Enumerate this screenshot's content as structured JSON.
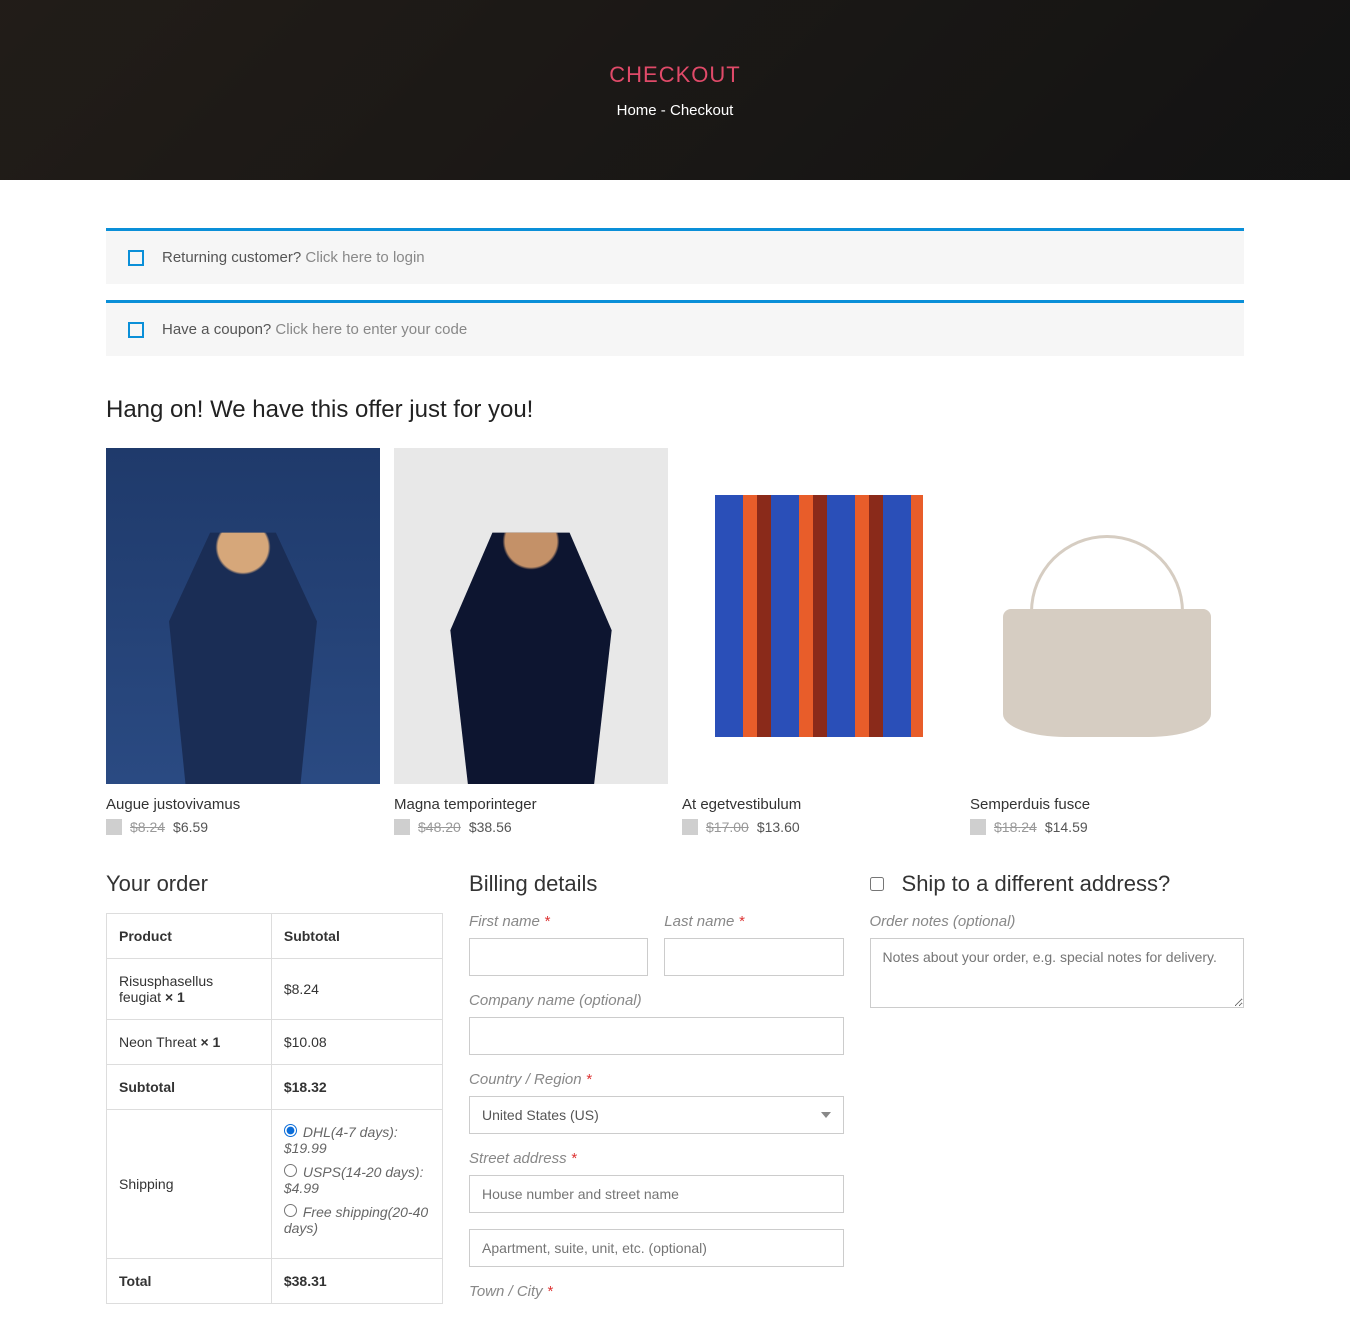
{
  "hero": {
    "title": "CHECKOUT",
    "breadcrumb_home": "Home",
    "breadcrumb_sep": " - ",
    "breadcrumb_current": "Checkout"
  },
  "notices": {
    "returning_prefix": "Returning customer? ",
    "returning_link": "Click here to login",
    "coupon_prefix": "Have a coupon? ",
    "coupon_link": "Click here to enter your code"
  },
  "offer_heading": "Hang on! We have this offer just for you!",
  "products": [
    {
      "title": "Augue justovivamus",
      "old": "$8.24",
      "new": "$6.59",
      "img": "img-jacket-denim"
    },
    {
      "title": "Magna temporinteger",
      "old": "$48.20",
      "new": "$38.56",
      "img": "img-jacket-navy"
    },
    {
      "title": "At egetvestibulum",
      "old": "$17.00",
      "new": "$13.60",
      "img": "img-scarf"
    },
    {
      "title": "Semperduis fusce",
      "old": "$18.24",
      "new": "$14.59",
      "img": "img-bag"
    }
  ],
  "order": {
    "heading": "Your order",
    "col_product": "Product",
    "col_subtotal": "Subtotal",
    "items": [
      {
        "name": "Risusphasellus feugiat ",
        "qty": "× 1",
        "subtotal": "$8.24"
      },
      {
        "name": "Neon Threat ",
        "qty": "× 1",
        "subtotal": "$10.08"
      }
    ],
    "subtotal_label": "Subtotal",
    "subtotal_value": "$18.32",
    "shipping_label": "Shipping",
    "shipping_options": [
      {
        "label": "DHL(4-7 days): $19.99",
        "checked": true
      },
      {
        "label": "USPS(14-20 days): $4.99",
        "checked": false
      },
      {
        "label": "Free shipping(20-40 days)",
        "checked": false
      }
    ],
    "total_label": "Total",
    "total_value": "$38.31"
  },
  "billing": {
    "heading": "Billing details",
    "first_name": "First name ",
    "last_name": "Last name ",
    "company": "Company name (optional)",
    "country": "Country / Region ",
    "country_value": "United States (US)",
    "street": "Street address ",
    "street1_ph": "House number and street name",
    "street2_ph": "Apartment, suite, unit, etc. (optional)",
    "town": "Town / City "
  },
  "ship_diff": {
    "heading": "Ship to a different address?",
    "notes_label": "Order notes (optional)",
    "notes_ph": "Notes about your order, e.g. special notes for delivery."
  }
}
